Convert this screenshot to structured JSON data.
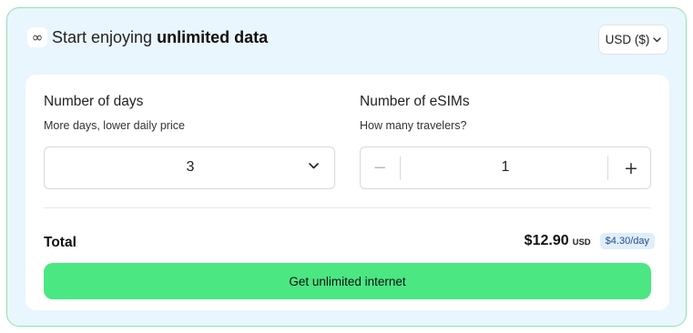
{
  "header": {
    "icon": "infinity-icon",
    "icon_glyph": "∞",
    "title_prefix": "Start enjoying",
    "title_bold": "unlimited data"
  },
  "currency": {
    "selected": "USD ($)",
    "icon": "chevron-down-icon"
  },
  "days": {
    "title": "Number of days",
    "subtitle": "More days, lower daily price",
    "value": "3",
    "icon": "chevron-down-icon"
  },
  "esims": {
    "title": "Number of eSIMs",
    "subtitle": "How many travelers?",
    "value": "1",
    "minus_glyph": "−",
    "plus_glyph": "+"
  },
  "total": {
    "label": "Total",
    "price": "$12.90",
    "currency": "USD",
    "per_day": "$4.30/day"
  },
  "cta": {
    "label": "Get unlimited internet"
  },
  "colors": {
    "card_background": "#e9f6fd",
    "card_border": "#8fe3ad",
    "cta_background": "#4ae783",
    "per_day_badge_bg": "#e0eefb",
    "per_day_badge_text": "#1d4e89"
  }
}
